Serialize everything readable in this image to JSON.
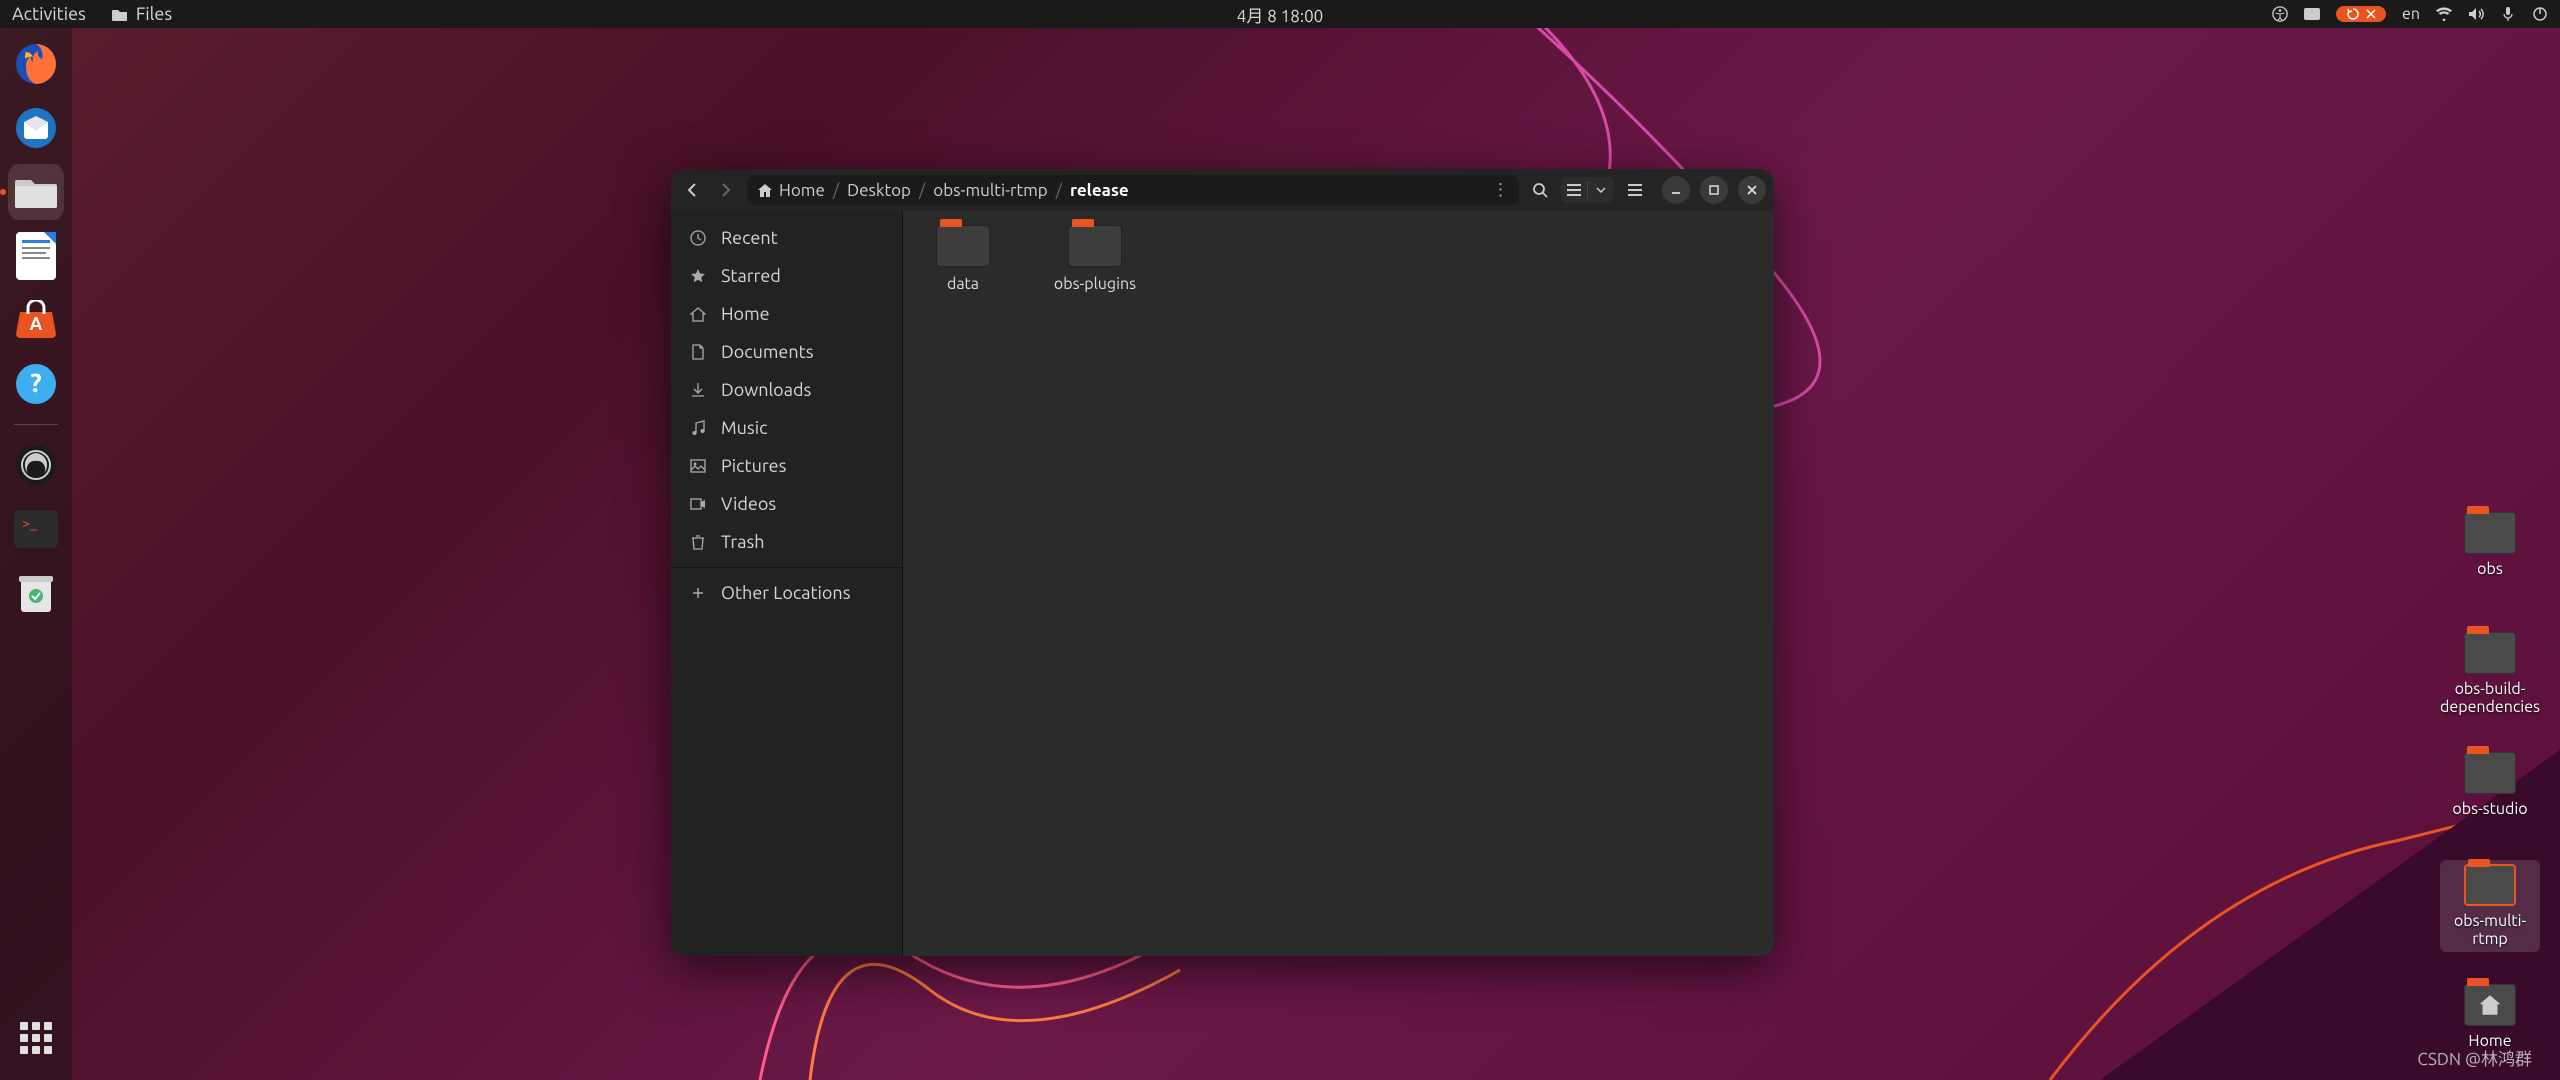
{
  "topbar": {
    "activities": "Activities",
    "app_name": "Files",
    "datetime": "4月 8  18:00",
    "language": "en",
    "pill_icons": [
      "reboot-icon",
      "close-icon"
    ]
  },
  "dock": {
    "items": [
      {
        "name": "firefox",
        "color": "#ff7139"
      },
      {
        "name": "thunderbird",
        "color": "#1f75c4"
      },
      {
        "name": "files",
        "color": "#e0e0e0",
        "active": true
      },
      {
        "name": "libreoffice-writer",
        "color": "#2a7de1"
      },
      {
        "name": "software-center",
        "color": "#e95420"
      },
      {
        "name": "help",
        "color": "#3eaef0"
      }
    ],
    "items2": [
      {
        "name": "obs",
        "color": "#1a1a1a"
      },
      {
        "name": "terminal",
        "color": "#2c2c2c"
      },
      {
        "name": "trash",
        "color": "#49b66f"
      }
    ]
  },
  "desktop": {
    "icons": [
      {
        "label": "obs"
      },
      {
        "label": "obs-build-dependencies"
      },
      {
        "label": "obs-studio"
      },
      {
        "label": "obs-multi-rtmp",
        "selected": true
      },
      {
        "label": "Home",
        "home": true
      }
    ]
  },
  "window": {
    "breadcrumb": [
      {
        "label": "Home",
        "home": true
      },
      {
        "label": "Desktop"
      },
      {
        "label": "obs-multi-rtmp"
      },
      {
        "label": "release",
        "current": true
      }
    ],
    "sidebar": [
      {
        "icon": "clock-icon",
        "label": "Recent"
      },
      {
        "icon": "star-icon",
        "label": "Starred"
      },
      {
        "icon": "home-icon",
        "label": "Home"
      },
      {
        "icon": "document-icon",
        "label": "Documents"
      },
      {
        "icon": "download-icon",
        "label": "Downloads"
      },
      {
        "icon": "music-icon",
        "label": "Music"
      },
      {
        "icon": "picture-icon",
        "label": "Pictures"
      },
      {
        "icon": "video-icon",
        "label": "Videos"
      },
      {
        "icon": "trash-icon",
        "label": "Trash"
      }
    ],
    "other_locations": "Other Locations",
    "files": [
      {
        "label": "data"
      },
      {
        "label": "obs-plugins"
      }
    ]
  },
  "watermark": "CSDN @林鸿群"
}
